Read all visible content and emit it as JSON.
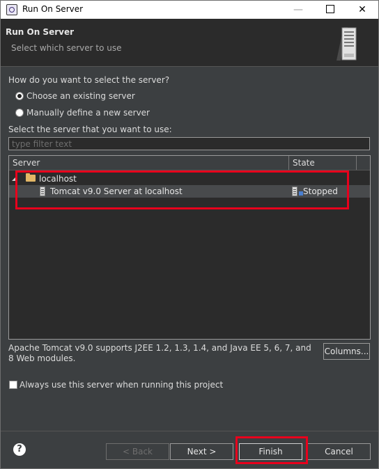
{
  "window": {
    "title": "Run On Server"
  },
  "banner": {
    "title": "Run On Server",
    "subtitle": "Select which server to use"
  },
  "selection": {
    "question": "How do you want to select the server?",
    "options": [
      {
        "label": "Choose an existing server",
        "selected": true
      },
      {
        "label": "Manually define a new server",
        "selected": false
      }
    ]
  },
  "server_list": {
    "prompt": "Select the server that you want to use:",
    "filter_placeholder": "type filter text",
    "columns": [
      "Server",
      "State"
    ],
    "groups": [
      {
        "name": "localhost",
        "servers": [
          {
            "name": "Tomcat v9.0 Server at localhost",
            "state": "Stopped"
          }
        ]
      }
    ]
  },
  "description": "Apache Tomcat v9.0 supports J2EE 1.2, 1.3, 1.4, and Java EE 5, 6, 7, and 8 Web modules.",
  "columns_button": "Columns...",
  "always_use": {
    "label": "Always use this server when running this project",
    "checked": false
  },
  "buttons": {
    "back": "< Back",
    "next": "Next >",
    "finish": "Finish",
    "cancel": "Cancel"
  },
  "colors": {
    "highlight": "#e8001c",
    "background": "#3c3f41",
    "selected_row": "#484a4c"
  }
}
